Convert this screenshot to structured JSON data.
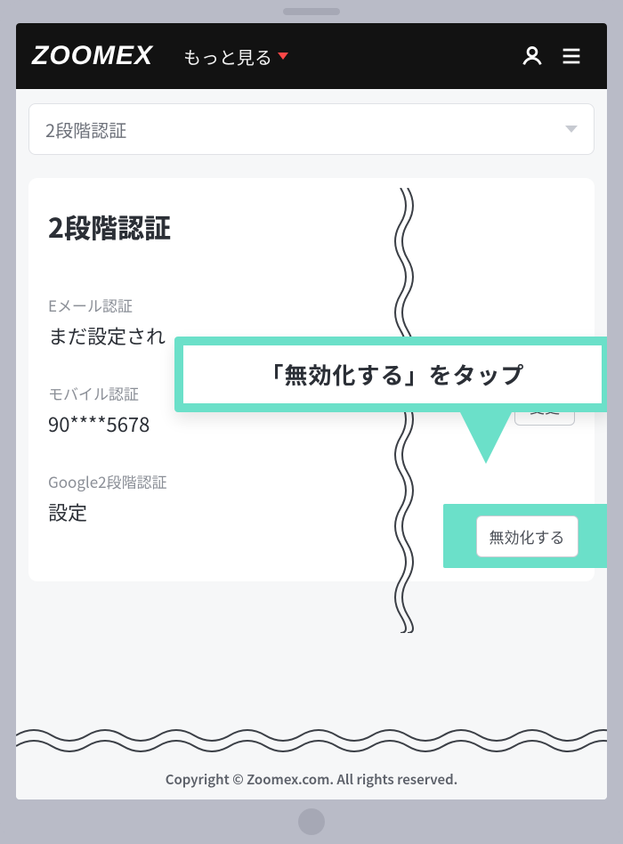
{
  "header": {
    "logo_text": "ZOOMEX",
    "more_label": "もっと見る"
  },
  "selector": {
    "current": "2段階認証"
  },
  "card": {
    "title": "2段階認証",
    "rows": {
      "email": {
        "label": "Eメール認証",
        "value": "まだ設定され"
      },
      "mobile": {
        "label": "モバイル認証",
        "value": "90****5678",
        "button": "変更"
      },
      "google": {
        "label": "Google2段階認証",
        "value": "設定",
        "button": "無効化する"
      }
    }
  },
  "callout": {
    "text": "「無効化する」をタップ"
  },
  "footer": {
    "copyright": "Copyright © Zoomex.com. All rights reserved."
  }
}
